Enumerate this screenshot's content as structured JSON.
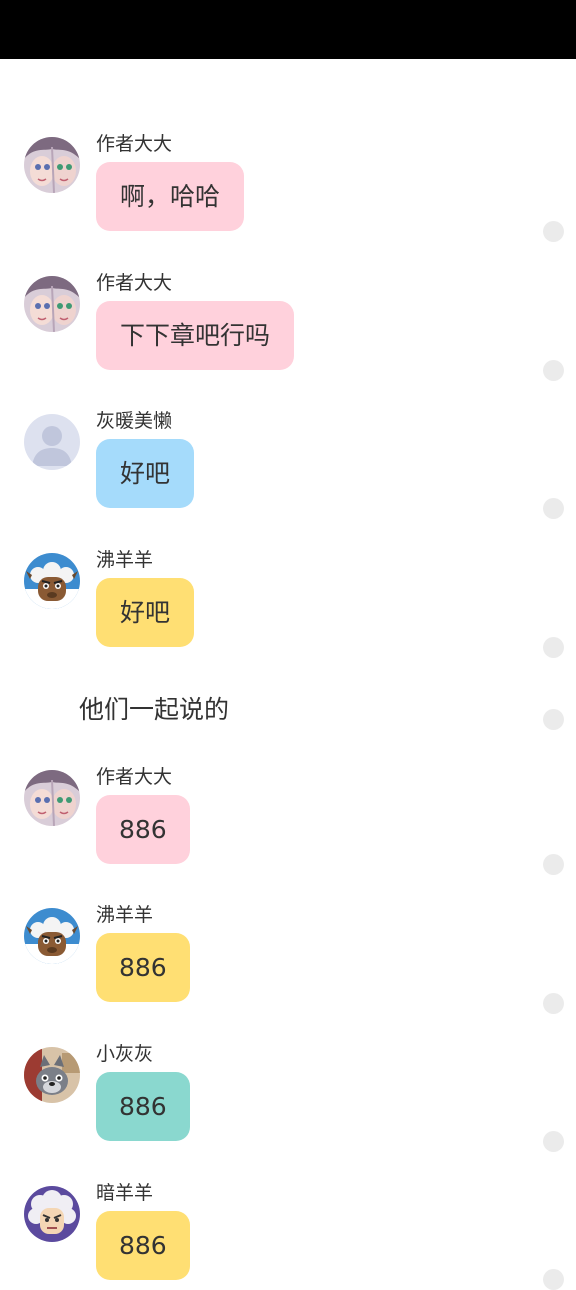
{
  "colors": {
    "author": "#ffd1dc",
    "hui_nuan_mei_lan": "#a5dbfb",
    "fei_yang_yang": "#ffdf73",
    "xiao_hui_hui": "#8ad8cf",
    "an_yang_yang": "#ffdf73",
    "status_bar": "#000000",
    "option_dot": "#ebebeb"
  },
  "messages": [
    {
      "sender": "作者大大",
      "text": "啊，哈哈",
      "avatar_icon": "anime-girls-avatar-icon"
    },
    {
      "sender": "作者大大",
      "text": "下下章吧行吗",
      "avatar_icon": "anime-girls-avatar-icon"
    },
    {
      "sender": "灰暖美懒",
      "text": "好吧",
      "avatar_icon": "default-user-avatar-icon"
    },
    {
      "sender": "沸羊羊",
      "text": "好吧",
      "avatar_icon": "goat-avatar-icon"
    },
    {
      "sender": "作者大大",
      "text": "886",
      "avatar_icon": "anime-girls-avatar-icon"
    },
    {
      "sender": "沸羊羊",
      "text": "886",
      "avatar_icon": "goat-avatar-icon"
    },
    {
      "sender": "小灰灰",
      "text": "886",
      "avatar_icon": "wolf-cub-avatar-icon"
    },
    {
      "sender": "暗羊羊",
      "text": "886",
      "avatar_icon": "dark-sheep-avatar-icon"
    }
  ],
  "narration": "他们一起说的"
}
